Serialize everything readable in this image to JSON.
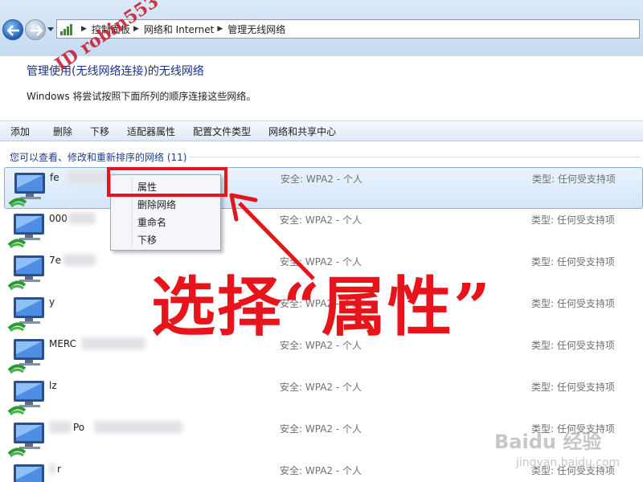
{
  "breadcrumb": [
    "控制面板",
    "网络和 Internet",
    "管理无线网络"
  ],
  "header": {
    "title": "管理使用(无线网络连接)的无线网络",
    "subtitle": "Windows 将尝试按照下面所列的顺序连接这些网络。"
  },
  "toolbar": {
    "add": "添加",
    "delete": "删除",
    "move_down": "下移",
    "adapter_properties": "适配器属性",
    "profile_type": "配置文件类型",
    "network_sharing_center": "网络和共享中心"
  },
  "list_header": "您可以查看、修改和重新排序的网络 (11)",
  "networks": [
    {
      "name": "fe",
      "security": "安全: WPA2 - 个人",
      "type": "类型: 任何受支持项",
      "selected": true
    },
    {
      "name": "000",
      "security": "安全: WPA2 - 个人",
      "type": "类型: 任何受支持项"
    },
    {
      "name": "7e",
      "security": "安全: WPA2 - 个人",
      "type": "类型: 任何受支持项"
    },
    {
      "name": "y",
      "security": "安全: WPA2 - 个人",
      "type": "类型: 任何受支持项"
    },
    {
      "name": "MERC",
      "security": "安全: WPA2 - 个人",
      "type": "类型: 任何受支持项"
    },
    {
      "name": "lz",
      "security": "安全: WPA2 - 个人",
      "type": "类型: 任何受支持项"
    },
    {
      "name": "Po",
      "security": "安全: WPA2 - 个人",
      "type": "类型: 任何受支持项"
    },
    {
      "name": "r",
      "security": "安全: WPA2 - 个人",
      "type": "类型: 任何受支持项"
    }
  ],
  "context_menu": {
    "properties": "属性",
    "delete_network": "删除网络",
    "rename": "重命名",
    "move_down": "下移"
  },
  "annotation": {
    "callout": "选择“属性”",
    "watermark_author": "ID robin553"
  },
  "watermark": {
    "logo": "Baidu 经验",
    "url": "jingyan.baidu.com"
  },
  "colors": {
    "annotation_red": "#e8141b",
    "link_blue": "#1e3287",
    "selection_border": "#84acdd"
  }
}
